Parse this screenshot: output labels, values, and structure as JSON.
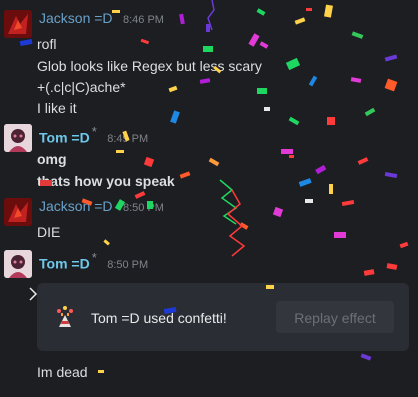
{
  "messages": [
    {
      "author": "Jackson =D",
      "time": "8:46 PM",
      "lines": [
        "rofl",
        "Glob looks like Regex but less scary",
        "+(.c|c|C)ache*",
        "I like it"
      ]
    },
    {
      "author": "Tom =D",
      "star": "*",
      "time": "8:49 PM",
      "lines": [
        "omg",
        "thats how you speak"
      ]
    },
    {
      "author": "Jackson =D",
      "time": "8:50 PM",
      "lines": [
        "DIE"
      ]
    },
    {
      "author": "Tom =D",
      "star": "*",
      "time": "8:50 PM",
      "effect": {
        "text": "Tom =D used confetti!",
        "button": "Replay effect"
      },
      "lines": [
        "Im dead"
      ]
    }
  ],
  "colors": {
    "background": "#1c1e22",
    "name_jackson": "#6aa1c9",
    "name_tom": "#6fc7ea"
  },
  "icons": {
    "effect": "confetti-party-popper-icon"
  }
}
